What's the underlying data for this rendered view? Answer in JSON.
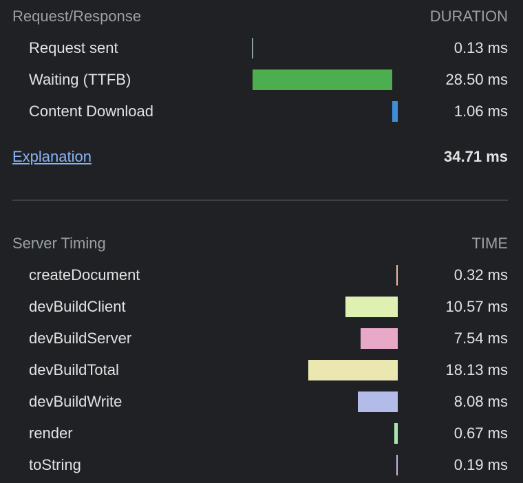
{
  "request_response": {
    "title": "Request/Response",
    "column_header": "DURATION",
    "rows": [
      {
        "label": "Request sent",
        "value": "0.13 ms",
        "duration_ms": 0.13,
        "color": "#8f9ea6"
      },
      {
        "label": "Waiting (TTFB)",
        "value": "28.50 ms",
        "duration_ms": 28.5,
        "color": "#4cae4f"
      },
      {
        "label": "Content Download",
        "value": "1.06 ms",
        "duration_ms": 1.06,
        "color": "#3d8fd9"
      }
    ],
    "explanation_link": "Explanation",
    "total": "34.71 ms"
  },
  "server_timing": {
    "title": "Server Timing",
    "column_header": "TIME",
    "rows": [
      {
        "label": "createDocument",
        "value": "0.32 ms",
        "duration_ms": 0.32,
        "color": "#f2b8a2"
      },
      {
        "label": "devBuildClient",
        "value": "10.57 ms",
        "duration_ms": 10.57,
        "color": "#dff0b3"
      },
      {
        "label": "devBuildServer",
        "value": "7.54 ms",
        "duration_ms": 7.54,
        "color": "#e8a8c8"
      },
      {
        "label": "devBuildTotal",
        "value": "18.13 ms",
        "duration_ms": 18.13,
        "color": "#eae8b0"
      },
      {
        "label": "devBuildWrite",
        "value": "8.08 ms",
        "duration_ms": 8.08,
        "color": "#b3bce8"
      },
      {
        "label": "render",
        "value": "0.67 ms",
        "duration_ms": 0.67,
        "color": "#a8e8b0"
      },
      {
        "label": "toString",
        "value": "0.19 ms",
        "duration_ms": 0.19,
        "color": "#c8b0e8"
      }
    ]
  }
}
